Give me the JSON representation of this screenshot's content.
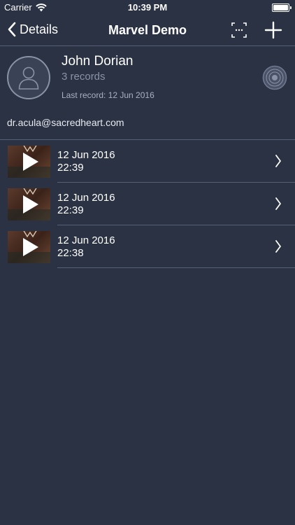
{
  "status_bar": {
    "carrier": "Carrier",
    "time": "10:39 PM"
  },
  "nav": {
    "back_label": "Details",
    "title": "Marvel Demo"
  },
  "profile": {
    "name": "John Dorian",
    "records_count": "3 records",
    "last_record": "Last record: 12 Jun 2016",
    "email": "dr.acula@sacredheart.com"
  },
  "records": [
    {
      "date": "12 Jun 2016",
      "time": "22:39"
    },
    {
      "date": "12 Jun 2016",
      "time": "22:39"
    },
    {
      "date": "12 Jun 2016",
      "time": "22:38"
    }
  ],
  "colors": {
    "background": "#2b3244",
    "divider": "#566077",
    "secondary_text": "#8a93a6"
  }
}
